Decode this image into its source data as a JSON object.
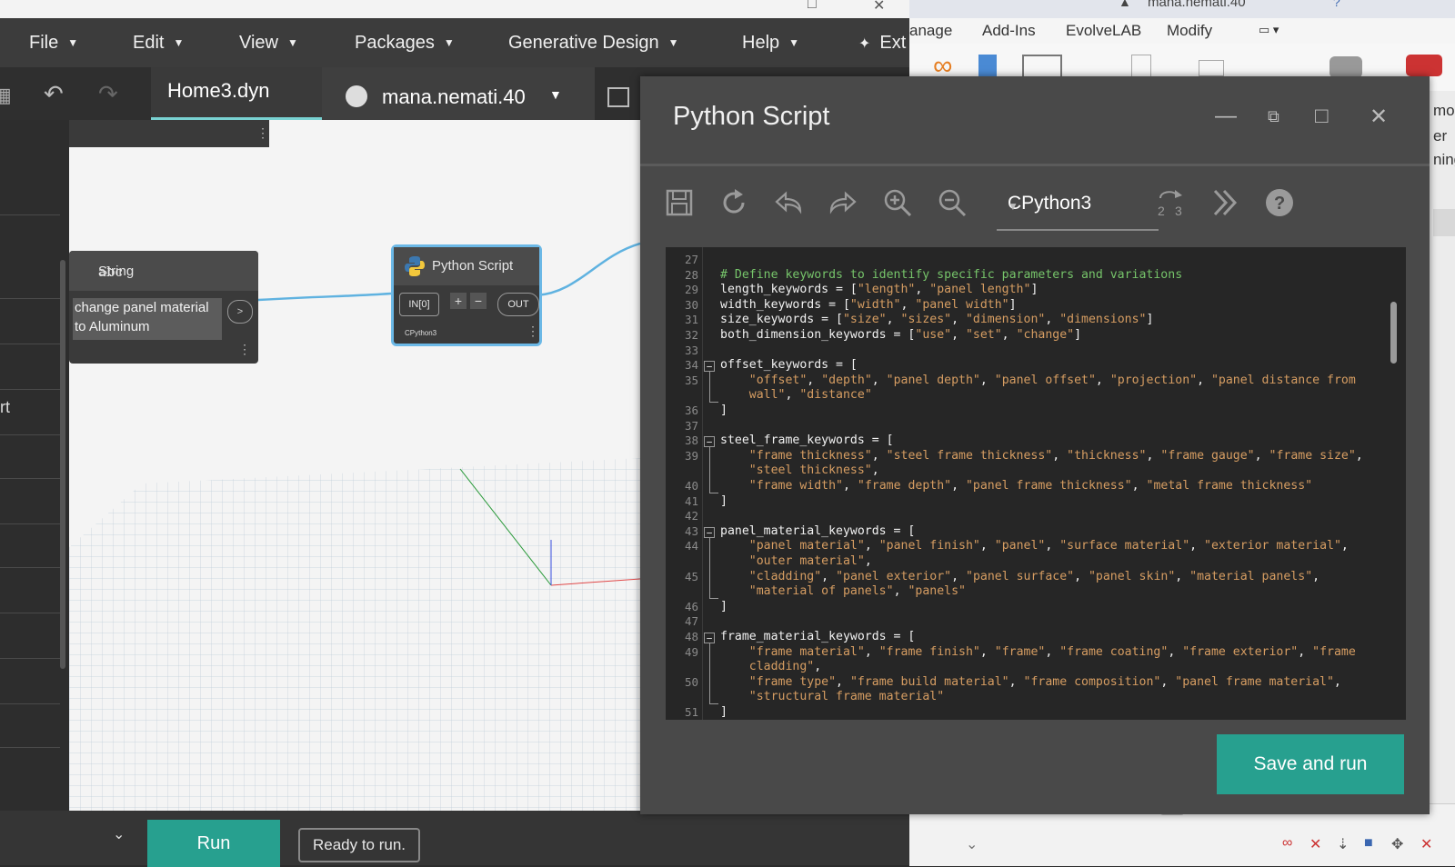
{
  "dynamo": {
    "menu": [
      {
        "label": "File"
      },
      {
        "label": "Edit"
      },
      {
        "label": "View"
      },
      {
        "label": "Packages"
      },
      {
        "label": "Generative Design"
      },
      {
        "label": "Help"
      },
      {
        "label": "Ext"
      }
    ],
    "active_tab": "Home3.dyn",
    "user": "mana.nemati.40",
    "library_partial_text": "rt",
    "nodes": {
      "string": {
        "type": "abc",
        "title": "String",
        "value": "change panel material to Aluminum",
        "port": ">"
      },
      "python": {
        "title": "Python Script",
        "input": "IN[0]",
        "output": "OUT",
        "plus": "+",
        "minus": "−",
        "engine": "CPython3"
      }
    },
    "run_button": "Run",
    "run_status": "Ready to run."
  },
  "revit": {
    "tabs": [
      "anage",
      "Add-Ins",
      "EvolveLAB",
      "Modify"
    ],
    "user": "mana.nemati.40",
    "side_text": [
      "mo",
      "er",
      "ning"
    ]
  },
  "editor": {
    "title": "Python Script",
    "engine": "CPython3",
    "save_run_label": "Save and run",
    "lines": [
      {
        "n": "27",
        "html": ""
      },
      {
        "n": "28",
        "html": "<span class=\"c\"># Define keywords to identify specific parameters and variations</span>"
      },
      {
        "n": "29",
        "html": "length_keywords = [<span class=\"s\">\"length\"</span>, <span class=\"s\">\"panel length\"</span>]"
      },
      {
        "n": "30",
        "html": "width_keywords = [<span class=\"s\">\"width\"</span>, <span class=\"s\">\"panel width\"</span>]"
      },
      {
        "n": "31",
        "html": "size_keywords = [<span class=\"s\">\"size\"</span>, <span class=\"s\">\"sizes\"</span>, <span class=\"s\">\"dimension\"</span>, <span class=\"s\">\"dimensions\"</span>]"
      },
      {
        "n": "32",
        "html": "both_dimension_keywords = [<span class=\"s\">\"use\"</span>, <span class=\"s\">\"set\"</span>, <span class=\"s\">\"change\"</span>]"
      },
      {
        "n": "33",
        "html": ""
      },
      {
        "n": "34",
        "html": "offset_keywords = ["
      },
      {
        "n": "35",
        "html": "    <span class=\"s\">\"offset\"</span>, <span class=\"s\">\"depth\"</span>, <span class=\"s\">\"panel depth\"</span>, <span class=\"s\">\"panel offset\"</span>, <span class=\"s\">\"projection\"</span>, <span class=\"s\">\"panel distance from</span>"
      },
      {
        "n": "",
        "html": "    <span class=\"s\">wall\"</span>, <span class=\"s\">\"distance\"</span>"
      },
      {
        "n": "36",
        "html": "]"
      },
      {
        "n": "37",
        "html": ""
      },
      {
        "n": "38",
        "html": "steel_frame_keywords = ["
      },
      {
        "n": "39",
        "html": "    <span class=\"s\">\"frame thickness\"</span>, <span class=\"s\">\"steel frame thickness\"</span>, <span class=\"s\">\"thickness\"</span>, <span class=\"s\">\"frame gauge\"</span>, <span class=\"s\">\"frame size\"</span>,"
      },
      {
        "n": "",
        "html": "    <span class=\"s\">\"steel thickness\"</span>,"
      },
      {
        "n": "40",
        "html": "    <span class=\"s\">\"frame width\"</span>, <span class=\"s\">\"frame depth\"</span>, <span class=\"s\">\"panel frame thickness\"</span>, <span class=\"s\">\"metal frame thickness\"</span>"
      },
      {
        "n": "41",
        "html": "]"
      },
      {
        "n": "42",
        "html": ""
      },
      {
        "n": "43",
        "html": "panel_material_keywords = ["
      },
      {
        "n": "44",
        "html": "    <span class=\"s\">\"panel material\"</span>, <span class=\"s\">\"panel finish\"</span>, <span class=\"s\">\"panel\"</span>, <span class=\"s\">\"surface material\"</span>, <span class=\"s\">\"exterior material\"</span>,"
      },
      {
        "n": "",
        "html": "    <span class=\"s\">\"outer material\"</span>,"
      },
      {
        "n": "45",
        "html": "    <span class=\"s\">\"cladding\"</span>, <span class=\"s\">\"panel exterior\"</span>, <span class=\"s\">\"panel surface\"</span>, <span class=\"s\">\"panel skin\"</span>, <span class=\"s\">\"material panels\"</span>,"
      },
      {
        "n": "",
        "html": "    <span class=\"s\">\"material of panels\"</span>, <span class=\"s\">\"panels\"</span>"
      },
      {
        "n": "46",
        "html": "]"
      },
      {
        "n": "47",
        "html": ""
      },
      {
        "n": "48",
        "html": "frame_material_keywords = ["
      },
      {
        "n": "49",
        "html": "    <span class=\"s\">\"frame material\"</span>, <span class=\"s\">\"frame finish\"</span>, <span class=\"s\">\"frame\"</span>, <span class=\"s\">\"frame coating\"</span>, <span class=\"s\">\"frame exterior\"</span>, <span class=\"s\">\"frame</span>"
      },
      {
        "n": "",
        "html": "    <span class=\"s\">cladding\"</span>,"
      },
      {
        "n": "50",
        "html": "    <span class=\"s\">\"frame type\"</span>, <span class=\"s\">\"frame build material\"</span>, <span class=\"s\">\"frame composition\"</span>, <span class=\"s\">\"panel frame material\"</span>,"
      },
      {
        "n": "",
        "html": "    <span class=\"s\">\"structural frame material\"</span>"
      },
      {
        "n": "51",
        "html": "]"
      }
    ]
  }
}
